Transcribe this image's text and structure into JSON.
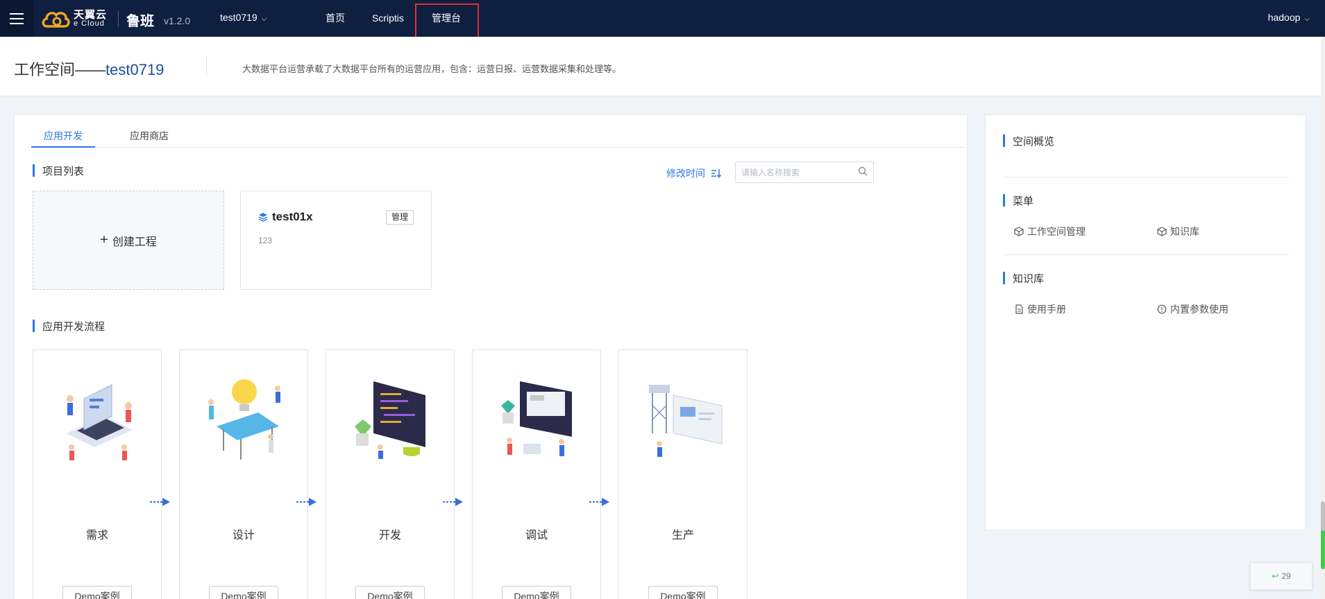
{
  "nav": {
    "logo_cn": "天翼云",
    "logo_en": "e Cloud",
    "product": "鲁班",
    "version": "v1.2.0",
    "workspace": "test0719",
    "items": [
      {
        "label": "首页"
      },
      {
        "label": "Scriptis"
      },
      {
        "label": "管理台"
      }
    ],
    "user": "hadoop"
  },
  "header": {
    "title_prefix": "工作空间——",
    "title_name": "test0719",
    "desc": "大数据平台运营承载了大数据平台所有的运营应用，包含：运营日报、运营数据采集和处理等。"
  },
  "main": {
    "tabs": [
      {
        "label": "应用开发"
      },
      {
        "label": "应用商店"
      }
    ],
    "projects_title": "项目列表",
    "sort_label": "修改时间",
    "search_placeholder": "请输入名称搜索",
    "create_label": "创建工程",
    "project": {
      "name": "test01x",
      "desc": "123",
      "manage_label": "管理"
    },
    "flow_title": "应用开发流程",
    "flow": [
      {
        "label": "需求",
        "demo": "Demo案例"
      },
      {
        "label": "设计",
        "demo": "Demo案例"
      },
      {
        "label": "开发",
        "demo": "Demo案例"
      },
      {
        "label": "调试",
        "demo": "Demo案例"
      },
      {
        "label": "生产",
        "demo": "Demo案例"
      }
    ]
  },
  "right": {
    "overview_title": "空间概览",
    "menu_title": "菜单",
    "menu_items": [
      {
        "label": "工作空间管理",
        "icon": "cube-icon"
      },
      {
        "label": "知识库",
        "icon": "cube-icon"
      }
    ],
    "kb_title": "知识库",
    "kb_items": [
      {
        "label": "使用手册",
        "icon": "document-icon"
      },
      {
        "label": "内置参数使用",
        "icon": "info-circle-icon"
      }
    ]
  },
  "badge": {
    "count": "29"
  },
  "colors": {
    "nav_bg": "#0f1f40",
    "accent": "#2d77e6",
    "highlight_box": "#e0313a"
  }
}
